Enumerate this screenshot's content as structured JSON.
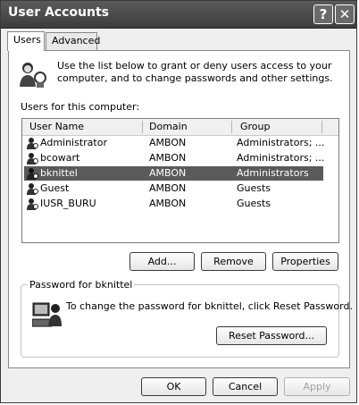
{
  "window": {
    "title": "User Accounts"
  },
  "tabs": [
    {
      "label": "Users"
    },
    {
      "label": "Advanced"
    }
  ],
  "intro": {
    "text": "Use the list below to grant or deny users access to your computer, and to change passwords and other settings."
  },
  "users_label": "Users for this computer:",
  "table": {
    "columns": [
      "User Name",
      "Domain",
      "Group"
    ],
    "rows": [
      {
        "name": "Administrator",
        "domain": "AMBON",
        "group": "Administrators; ..."
      },
      {
        "name": "bcowart",
        "domain": "AMBON",
        "group": "Administrators; ..."
      },
      {
        "name": "bknittel",
        "domain": "AMBON",
        "group": "Administrators"
      },
      {
        "name": "Guest",
        "domain": "AMBON",
        "group": "Guests"
      },
      {
        "name": "IUSR_BURU",
        "domain": "AMBON",
        "group": "Guests"
      }
    ],
    "selected_index": 2
  },
  "buttons": {
    "add": "Add...",
    "remove": "Remove",
    "properties": "Properties"
  },
  "password_group": {
    "title": "Password for bknittel",
    "text": "To change the password for bknittel, click Reset Password.",
    "reset_button": "Reset Password..."
  },
  "footer": {
    "ok": "OK",
    "cancel": "Cancel",
    "apply": "Apply"
  },
  "colors": {
    "selection": "#5a5a5a",
    "titlebar": "#4a4a4a"
  },
  "icons": {
    "help": "help-icon",
    "close": "close-icon",
    "users": "users-icon",
    "user": "user-icon",
    "password": "computer-user-icon"
  }
}
